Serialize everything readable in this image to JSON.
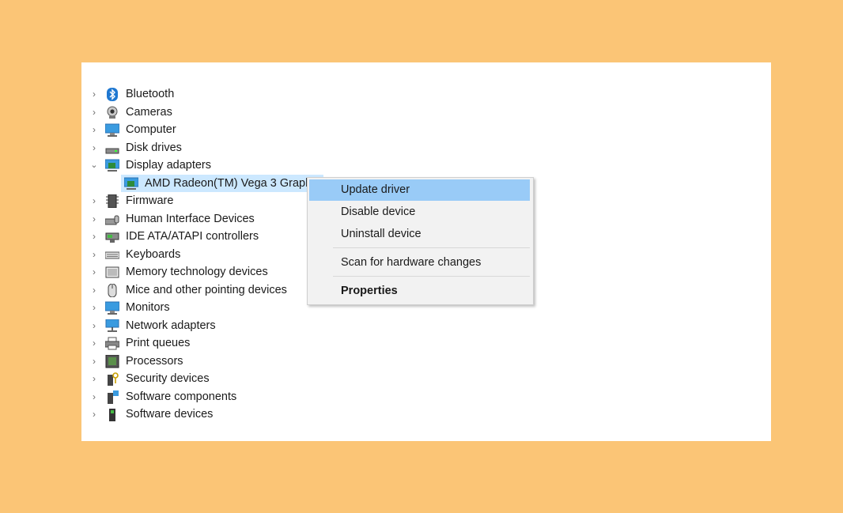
{
  "tree": {
    "items": [
      {
        "label": "Bluetooth",
        "icon": "bluetooth-icon",
        "expanded": false
      },
      {
        "label": "Cameras",
        "icon": "camera-icon",
        "expanded": false
      },
      {
        "label": "Computer",
        "icon": "computer-icon",
        "expanded": false
      },
      {
        "label": "Disk drives",
        "icon": "disk-drive-icon",
        "expanded": false
      },
      {
        "label": "Display adapters",
        "icon": "display-adapter-icon",
        "expanded": true,
        "children": [
          {
            "label": "AMD Radeon(TM) Vega 3 Graph",
            "icon": "display-adapter-icon",
            "selected": true
          }
        ]
      },
      {
        "label": "Firmware",
        "icon": "firmware-icon",
        "expanded": false
      },
      {
        "label": "Human Interface Devices",
        "icon": "hid-icon",
        "expanded": false
      },
      {
        "label": "IDE ATA/ATAPI controllers",
        "icon": "ide-controller-icon",
        "expanded": false
      },
      {
        "label": "Keyboards",
        "icon": "keyboard-icon",
        "expanded": false
      },
      {
        "label": "Memory technology devices",
        "icon": "memory-device-icon",
        "expanded": false
      },
      {
        "label": "Mice and other pointing devices",
        "icon": "mouse-icon",
        "expanded": false
      },
      {
        "label": "Monitors",
        "icon": "monitor-icon",
        "expanded": false
      },
      {
        "label": "Network adapters",
        "icon": "network-adapter-icon",
        "expanded": false
      },
      {
        "label": "Print queues",
        "icon": "printer-icon",
        "expanded": false
      },
      {
        "label": "Processors",
        "icon": "processor-icon",
        "expanded": false
      },
      {
        "label": "Security devices",
        "icon": "security-device-icon",
        "expanded": false
      },
      {
        "label": "Software components",
        "icon": "software-component-icon",
        "expanded": false
      },
      {
        "label": "Software devices",
        "icon": "software-device-icon",
        "expanded": false
      }
    ]
  },
  "context_menu": {
    "update_driver": "Update driver",
    "disable_device": "Disable device",
    "uninstall_device": "Uninstall device",
    "scan_hardware": "Scan for hardware changes",
    "properties": "Properties"
  },
  "colors": {
    "background": "#fbc576",
    "selection": "#cce8ff",
    "menu_highlight": "#99cbf7"
  }
}
